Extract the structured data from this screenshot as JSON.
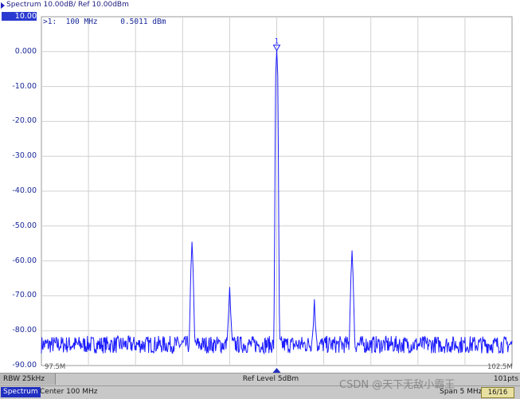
{
  "title": "Spectrum 10.00dB/ Ref 10.00dBm",
  "y_labels": [
    "10.00",
    "0.000",
    "-10.00",
    "-20.00",
    "-30.00",
    "-40.00",
    "-50.00",
    "-60.00",
    "-70.00",
    "-80.00",
    "-90.00"
  ],
  "marker": {
    "text": ">1:  100 MHz     0.5011 dBm",
    "number": "1"
  },
  "x_start": "97.5M",
  "x_stop": "102.5M",
  "status_bar": {
    "rbw": "RBW 25kHz",
    "ref_level": "Ref Level 5dBm",
    "points": "101pts"
  },
  "bottom_bar": {
    "mode": "Spectrum",
    "center": "Center 100 MHz",
    "span": "Span 5 MHz",
    "count": "16/16"
  },
  "watermark": "CSDN @天下无敌小霸王",
  "colors": {
    "trace": "#1c1cff",
    "grid": "#d0d0d0",
    "accent": "#2030c0"
  },
  "chart_data": {
    "type": "line",
    "title": "Spectrum 10.00dB/ Ref 10.00dBm",
    "x_unit": "MHz",
    "xlim": [
      97.5,
      102.5
    ],
    "ylim": [
      -90,
      10
    ],
    "y_step": 10,
    "grid": true,
    "noise_floor": -84,
    "peaks": [
      {
        "x": 99.1,
        "y": -54.5
      },
      {
        "x": 99.5,
        "y": -67.5
      },
      {
        "x": 100.0,
        "y": 0.5011
      },
      {
        "x": 100.4,
        "y": -71.0
      },
      {
        "x": 100.8,
        "y": -57.0
      }
    ],
    "marker": {
      "id": 1,
      "x": 100.0,
      "y": 0.5011
    }
  }
}
